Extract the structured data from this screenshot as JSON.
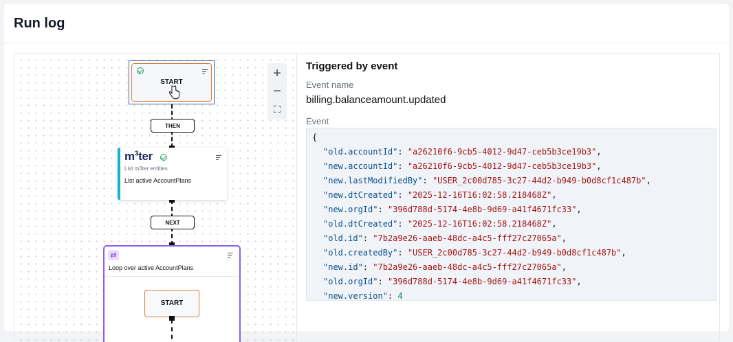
{
  "page": {
    "title": "Run log"
  },
  "flow": {
    "start_label": "START",
    "edge_then": "THEN",
    "edge_next": "NEXT",
    "m3ter_node": {
      "logo": "m",
      "logo_sup": "3",
      "logo_rest": "ter",
      "subtitle": "List m3ter entities",
      "title": "List active AccountPlans"
    },
    "loop_node": {
      "title": "Loop over active AccountPlans",
      "inner_start": "START"
    },
    "zoom": {
      "in": "+",
      "out": "−",
      "fit": "⛶"
    }
  },
  "details": {
    "heading": "Triggered by event",
    "event_name_label": "Event name",
    "event_name": "billing.balanceamount.updated",
    "event_label": "Event",
    "event_json": {
      "open_brace": "{",
      "entries": [
        {
          "key": "\"old.accountId\"",
          "value": "\"a26210f6-9cb5-4012-9d47-ceb5b3ce19b3\"",
          "kind": "string"
        },
        {
          "key": "\"new.accountId\"",
          "value": "\"a26210f6-9cb5-4012-9d47-ceb5b3ce19b3\"",
          "kind": "string"
        },
        {
          "key": "\"new.lastModifiedBy\"",
          "value": "\"USER_2c00d785-3c27-44d2-b949-b0d8cf1c487b\"",
          "kind": "string"
        },
        {
          "key": "\"new.dtCreated\"",
          "value": "\"2025-12-16T16:02:58.218468Z\"",
          "kind": "string"
        },
        {
          "key": "\"new.orgId\"",
          "value": "\"396d788d-5174-4e8b-9d69-a41f4671fc33\"",
          "kind": "string"
        },
        {
          "key": "\"old.dtCreated\"",
          "value": "\"2025-12-16T16:02:58.218468Z\"",
          "kind": "string"
        },
        {
          "key": "\"old.id\"",
          "value": "\"7b2a9e26-aaeb-48dc-a4c5-fff27c27065a\"",
          "kind": "string"
        },
        {
          "key": "\"old.createdBy\"",
          "value": "\"USER_2c00d785-3c27-44d2-b949-b0d8cf1c487b\"",
          "kind": "string"
        },
        {
          "key": "\"new.id\"",
          "value": "\"7b2a9e26-aaeb-48dc-a4c5-fff27c27065a\"",
          "kind": "string"
        },
        {
          "key": "\"old.orgId\"",
          "value": "\"396d788d-5174-4e8b-9d69-a41f4671fc33\"",
          "kind": "string"
        },
        {
          "key": "\"new.version\"",
          "value": "4",
          "kind": "number"
        }
      ]
    }
  }
}
